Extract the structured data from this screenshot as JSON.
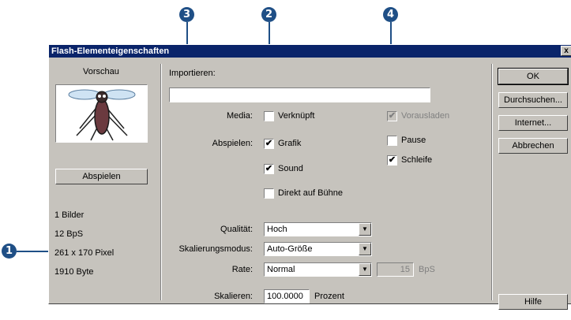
{
  "callouts": [
    "1",
    "2",
    "3",
    "4"
  ],
  "window": {
    "title": "Flash-Elementeigenschaften",
    "close_glyph": "x"
  },
  "preview": {
    "label": "Vorschau",
    "play_button": "Abspielen",
    "info": [
      "1 Bilder",
      "12 BpS",
      "261 x 170 Pixel",
      "1910 Byte"
    ]
  },
  "import": {
    "label": "Importieren:",
    "value": ""
  },
  "media": {
    "label": "Media:",
    "linked_label": "Verknüpft",
    "linked_checked": false,
    "preload_label": "Vorausladen",
    "preload_checked": true,
    "preload_disabled": true
  },
  "playback": {
    "label": "Abspielen:",
    "graphic_label": "Grafik",
    "graphic_checked": true,
    "sound_label": "Sound",
    "sound_checked": true,
    "direct_label": "Direkt auf Bühne",
    "direct_checked": false,
    "pause_label": "Pause",
    "pause_checked": false,
    "loop_label": "Schleife",
    "loop_checked": true
  },
  "quality": {
    "label": "Qualität:",
    "value": "Hoch"
  },
  "scaling_mode": {
    "label": "Skalierungsmodus:",
    "value": "Auto-Größe"
  },
  "rate": {
    "label": "Rate:",
    "value": "Normal",
    "fps_value": "15",
    "fps_unit": "BpS"
  },
  "scale": {
    "label": "Skalieren:",
    "value": "100.0000",
    "unit": "Prozent"
  },
  "buttons": {
    "ok": "OK",
    "browse": "Durchsuchen...",
    "internet": "Internet...",
    "cancel": "Abbrechen",
    "help": "Hilfe"
  },
  "colors": {
    "dialog_bg": "#c6c3bd",
    "titlebar": "#0a246a",
    "callout": "#1f4f86"
  }
}
